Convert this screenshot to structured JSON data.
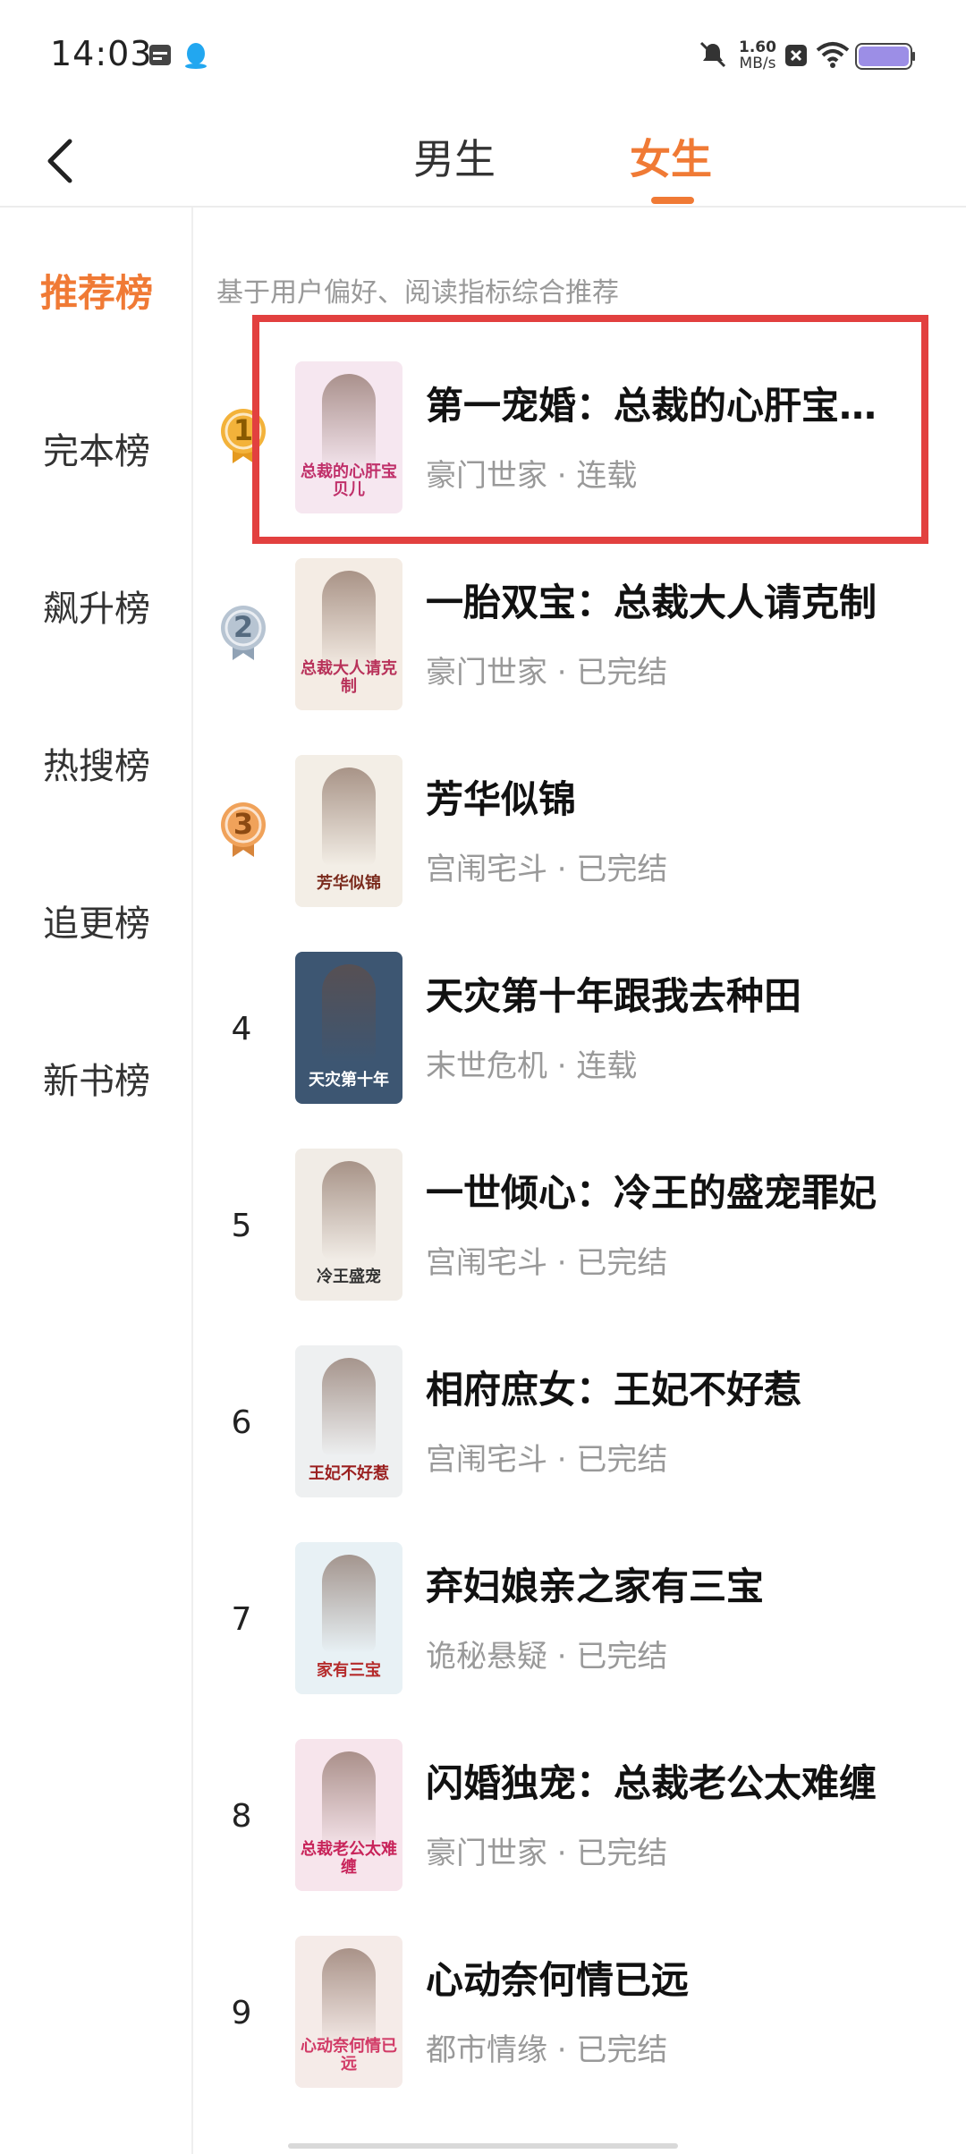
{
  "status_bar": {
    "time": "14:03",
    "net_speed_value": "1.60",
    "net_speed_unit": "MB/s",
    "icons": [
      "calendar-app-icon",
      "qq-app-icon",
      "mute-icon",
      "close-square-icon",
      "wifi-icon",
      "battery-icon"
    ]
  },
  "header": {
    "tabs": [
      {
        "label": "男生",
        "active": false
      },
      {
        "label": "女生",
        "active": true
      }
    ],
    "accent_color": "#f07a35"
  },
  "sidebar": {
    "items": [
      {
        "label": "推荐榜",
        "active": true
      },
      {
        "label": "完本榜",
        "active": false
      },
      {
        "label": "飙升榜",
        "active": false
      },
      {
        "label": "热搜榜",
        "active": false
      },
      {
        "label": "追更榜",
        "active": false
      },
      {
        "label": "新书榜",
        "active": false
      }
    ]
  },
  "main": {
    "subtitle": "基于用户偏好、阅读指标综合推荐",
    "books": [
      {
        "rank": "1",
        "title": "第一宠婚：总裁的心肝宝…",
        "meta": "豪门世家 · 连载",
        "cover_text": "总裁的心肝宝贝儿",
        "cover_bg": "#f6e7f0",
        "cover_color": "#c0306a"
      },
      {
        "rank": "2",
        "title": "一胎双宝：总裁大人请克制",
        "meta": "豪门世家 · 已完结",
        "cover_text": "总裁大人请克制",
        "cover_bg": "#f4ece4",
        "cover_color": "#b8325a"
      },
      {
        "rank": "3",
        "title": "芳华似锦",
        "meta": "宫闱宅斗 · 已完结",
        "cover_text": "芳华似锦",
        "cover_bg": "#f3eee6",
        "cover_color": "#7a2a1c"
      },
      {
        "rank": "4",
        "title": "天灾第十年跟我去种田",
        "meta": "末世危机 · 连载",
        "cover_text": "天灾第十年",
        "cover_bg": "#3d5672",
        "cover_color": "#ffffff"
      },
      {
        "rank": "5",
        "title": "一世倾心：冷王的盛宠罪妃",
        "meta": "宫闱宅斗 · 已完结",
        "cover_text": "冷王盛宠",
        "cover_bg": "#f1ece6",
        "cover_color": "#333333"
      },
      {
        "rank": "6",
        "title": "相府庶女：王妃不好惹",
        "meta": "宫闱宅斗 · 已完结",
        "cover_text": "王妃不好惹",
        "cover_bg": "#eef0f1",
        "cover_color": "#9a1f1f"
      },
      {
        "rank": "7",
        "title": "弃妇娘亲之家有三宝",
        "meta": "诡秘悬疑 · 已完结",
        "cover_text": "家有三宝",
        "cover_bg": "#e8f1f5",
        "cover_color": "#b52b2b"
      },
      {
        "rank": "8",
        "title": "闪婚独宠：总裁老公太难缠",
        "meta": "豪门世家 · 已完结",
        "cover_text": "总裁老公太难缠",
        "cover_bg": "#f7e5ec",
        "cover_color": "#c8245a"
      },
      {
        "rank": "9",
        "title": "心动奈何情已远",
        "meta": "都市情缘 · 已完结",
        "cover_text": "心动奈何情已远",
        "cover_bg": "#f5ebe8",
        "cover_color": "#d13a66"
      }
    ]
  },
  "highlight_color": "#e2403f"
}
